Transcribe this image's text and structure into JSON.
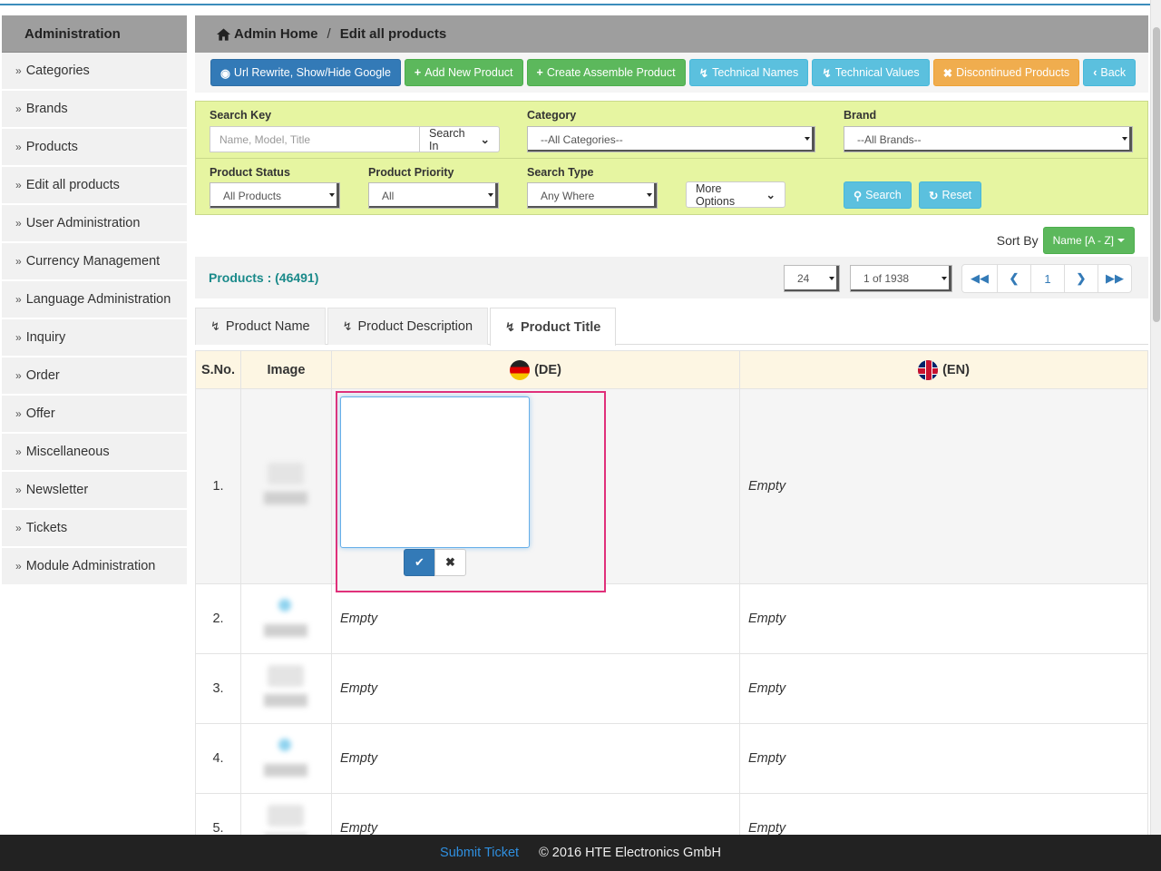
{
  "sidebar": {
    "title": "Administration",
    "items": [
      {
        "label": "Categories"
      },
      {
        "label": "Brands"
      },
      {
        "label": "Products"
      },
      {
        "label": "Edit all products"
      },
      {
        "label": "User Administration"
      },
      {
        "label": "Currency Management"
      },
      {
        "label": "Language Administration"
      },
      {
        "label": "Inquiry"
      },
      {
        "label": "Order"
      },
      {
        "label": "Offer"
      },
      {
        "label": "Miscellaneous"
      },
      {
        "label": "Newsletter"
      },
      {
        "label": "Tickets"
      },
      {
        "label": "Module Administration"
      }
    ]
  },
  "breadcrumb": {
    "home": "Admin Home",
    "separator": "/",
    "current": "Edit all products"
  },
  "toolbar": {
    "url_rewrite": "Url Rewrite, Show/Hide Google",
    "add_new_product": "Add New Product",
    "create_assemble_product": "Create Assemble Product",
    "technical_names": "Technical Names",
    "technical_values": "Technical Values",
    "discontinued_products": "Discontinued Products",
    "back": "Back"
  },
  "filters": {
    "search_key_label": "Search Key",
    "search_key_placeholder": "Name, Model, Title",
    "search_in": "Search In",
    "category_label": "Category",
    "category_value": "--All Categories--",
    "brand_label": "Brand",
    "brand_value": "--All Brands--",
    "status_label": "Product Status",
    "status_value": "All Products",
    "priority_label": "Product Priority",
    "priority_value": "All",
    "search_type_label": "Search Type",
    "search_type_value": "Any Where",
    "more_options": "More Options",
    "search_button": "Search",
    "reset_button": "Reset"
  },
  "sort": {
    "label": "Sort By",
    "value": "Name [A - Z]"
  },
  "products": {
    "title": "Products : (46491)",
    "per_page": "24",
    "page_select": "1 of 1938",
    "current_page": "1"
  },
  "tabs": [
    {
      "label": "Product Name"
    },
    {
      "label": "Product Description"
    },
    {
      "label": "Product Title"
    }
  ],
  "table": {
    "headers": {
      "sno": "S.No.",
      "image": "Image",
      "de": "(DE)",
      "en": "(EN)"
    },
    "rows": [
      {
        "sno": "1.",
        "de": "",
        "en": "Empty"
      },
      {
        "sno": "2.",
        "de": "Empty",
        "en": "Empty"
      },
      {
        "sno": "3.",
        "de": "Empty",
        "en": "Empty"
      },
      {
        "sno": "4.",
        "de": "Empty",
        "en": "Empty"
      },
      {
        "sno": "5.",
        "de": "Empty",
        "en": "Empty"
      }
    ]
  },
  "footer": {
    "link": "Submit Ticket",
    "copyright": "© 2016 HTE Electronics GmbH"
  },
  "colors": {
    "accent": "#3c8dbc",
    "filter_bg": "#e6f5a1",
    "editor_border": "#e0307a",
    "footer_bg": "#222222"
  }
}
